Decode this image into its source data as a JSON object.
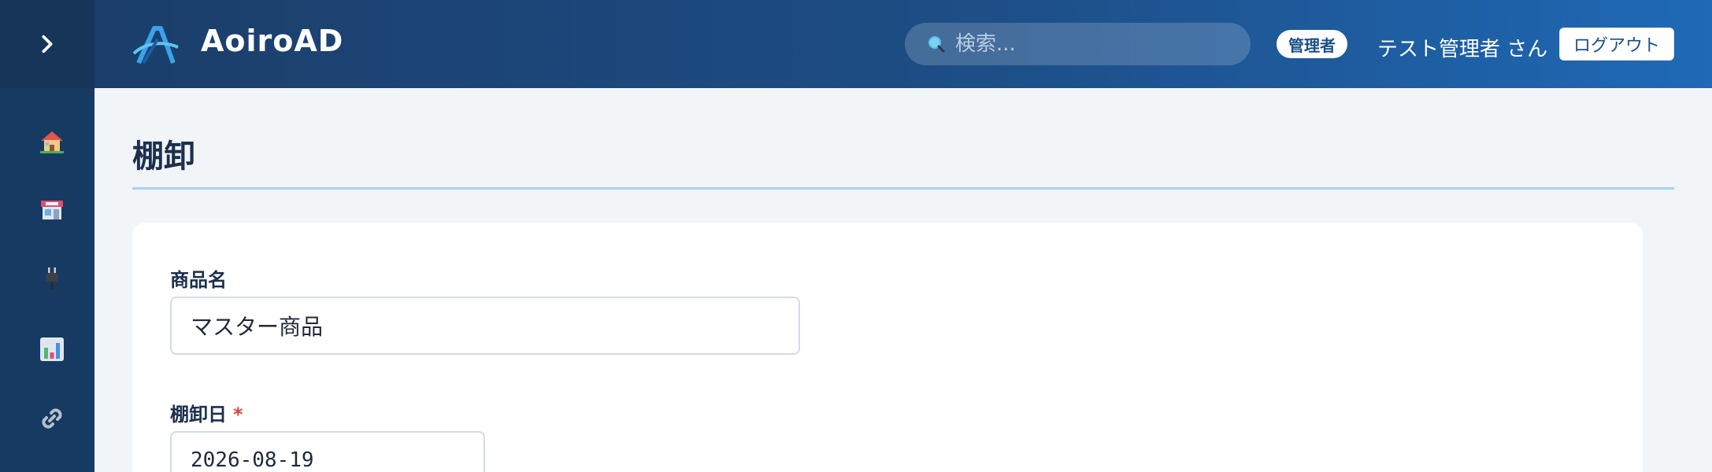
{
  "app": {
    "brand": "AoiroAD"
  },
  "sidebar": {
    "toggle_icon": "chevron-right-icon",
    "items": [
      {
        "icon": "house-icon"
      },
      {
        "icon": "store-icon"
      },
      {
        "icon": "plug-icon"
      },
      {
        "icon": "bar-chart-icon"
      },
      {
        "icon": "link-icon"
      }
    ]
  },
  "header": {
    "search": {
      "placeholder": "検索..."
    },
    "role_badge": "管理者",
    "user_name": "テスト管理者 さん",
    "logout_label": "ログアウト"
  },
  "page": {
    "title": "棚卸"
  },
  "form": {
    "product_name": {
      "label": "商品名",
      "value": "マスター商品"
    },
    "inventory_date": {
      "label": "棚卸日",
      "required_mark": "*",
      "value": "2026-08-19"
    }
  },
  "colors": {
    "sidebar_bg": "#173a62",
    "header_gradient_start": "#1b3e6a",
    "header_gradient_end": "#1f69b6",
    "accent_rule": "#a9d2f1",
    "required": "#e0443a"
  }
}
